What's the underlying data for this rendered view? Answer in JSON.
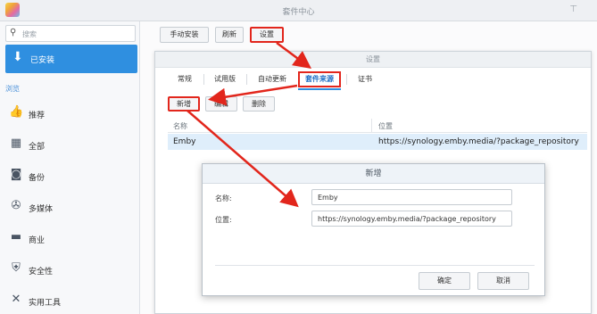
{
  "window": {
    "title": "套件中心"
  },
  "sidebar": {
    "search_placeholder": "搜索",
    "installed_label": "已安装",
    "section_title": "浏览",
    "items": [
      {
        "label": "推荐",
        "icon": "thumbs-up-icon"
      },
      {
        "label": "全部",
        "icon": "grid-icon"
      },
      {
        "label": "备份",
        "icon": "backup-icon"
      },
      {
        "label": "多媒体",
        "icon": "film-reel-icon"
      },
      {
        "label": "商业",
        "icon": "briefcase-icon"
      },
      {
        "label": "安全性",
        "icon": "shield-icon"
      },
      {
        "label": "实用工具",
        "icon": "tools-icon"
      }
    ]
  },
  "toolbar": {
    "manual_install": "手动安装",
    "refresh": "刷新",
    "settings": "设置"
  },
  "settings_dialog": {
    "title": "设置",
    "tabs": [
      "常规",
      "试用版",
      "自动更新",
      "套件来源",
      "证书"
    ],
    "active_tab": "套件来源",
    "buttons": {
      "add": "新增",
      "edit": "编辑",
      "delete": "删除"
    },
    "table": {
      "headers": [
        "名称",
        "位置"
      ],
      "rows": [
        {
          "name": "Emby",
          "location": "https://synology.emby.media/?package_repository"
        }
      ]
    }
  },
  "add_dialog": {
    "title": "新增",
    "name_label": "名称:",
    "name_value": "Emby",
    "location_label": "位置:",
    "location_value": "https://synology.emby.media/?package_repository",
    "ok": "确定",
    "cancel": "取消"
  },
  "colors": {
    "accent": "#2f8fe0",
    "highlight": "#e2261c"
  }
}
